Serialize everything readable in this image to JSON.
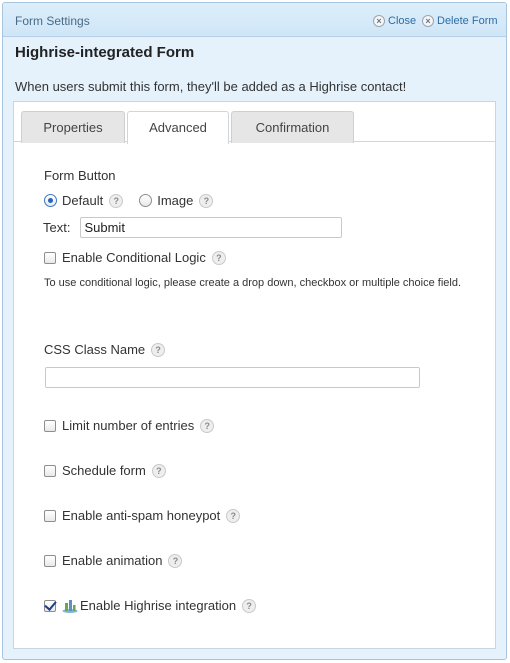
{
  "header": {
    "title": "Form Settings",
    "close_label": "Close",
    "delete_label": "Delete Form"
  },
  "form": {
    "name": "Highrise-integrated Form",
    "description": "When users submit this form, they'll be added as a Highrise contact!"
  },
  "tabs": [
    {
      "label": "Properties",
      "active": false
    },
    {
      "label": "Advanced",
      "active": true
    },
    {
      "label": "Confirmation",
      "active": false
    }
  ],
  "advanced": {
    "form_button_label": "Form Button",
    "button_type_options": [
      {
        "label": "Default",
        "selected": true
      },
      {
        "label": "Image",
        "selected": false
      }
    ],
    "text_label": "Text:",
    "text_value": "Submit",
    "conditional_logic_label": "Enable Conditional Logic",
    "conditional_logic_checked": false,
    "conditional_note": "To use conditional logic, please create a drop down, checkbox or multiple choice field.",
    "css_class_label": "CSS Class Name",
    "css_class_value": "",
    "limit_entries_label": "Limit number of entries",
    "limit_entries_checked": false,
    "schedule_label": "Schedule form",
    "schedule_checked": false,
    "honeypot_label": "Enable anti-spam honeypot",
    "honeypot_checked": false,
    "animation_label": "Enable animation",
    "animation_checked": false,
    "highrise_label": "Enable Highrise integration",
    "highrise_checked": true
  },
  "help_glyph": "?",
  "close_glyph": "×"
}
